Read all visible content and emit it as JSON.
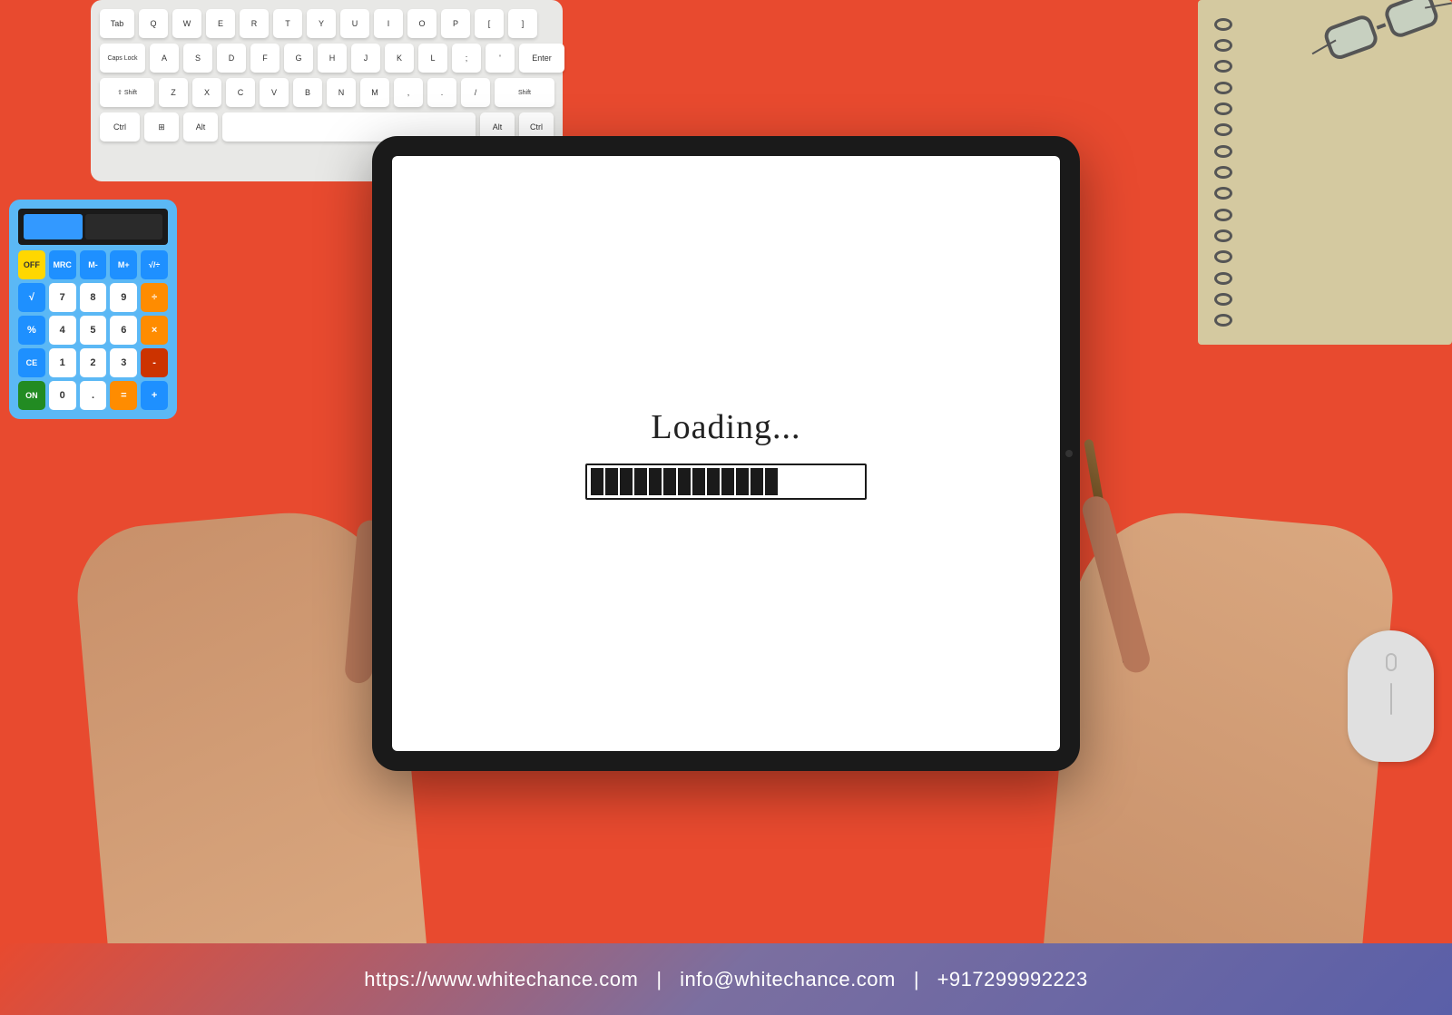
{
  "scene": {
    "background_color": "#e84a2f",
    "tablet": {
      "loading_text": "Loading...",
      "progress_segments": 13,
      "camera_dot": true
    },
    "calculator": {
      "rows": [
        [
          "OFF",
          "MRC",
          "M-",
          "M+",
          "√/÷"
        ],
        [
          "√",
          "7",
          "8",
          "9",
          "÷"
        ],
        [
          "%",
          "4",
          "5",
          "6",
          "×"
        ],
        [
          "CE",
          "1",
          "2",
          "3",
          "-"
        ],
        [
          "ON",
          "0",
          ".",
          "=",
          "+"
        ]
      ]
    },
    "keyboard": {
      "rows": [
        [
          "Tab",
          "Q",
          "W",
          "E",
          "R",
          "T",
          "Y",
          "U",
          "I",
          "O",
          "P"
        ],
        [
          "Caps Lock",
          "A",
          "S",
          "D",
          "F",
          "G",
          "H",
          "J",
          "K",
          "L"
        ],
        [
          "Shift",
          "Z",
          "X",
          "C",
          "V",
          "B",
          "N",
          "M"
        ],
        [
          "Ctrl",
          "Alt",
          "Ctrl"
        ]
      ]
    }
  },
  "footer": {
    "website": "https://www.whitechance.com",
    "divider1": "|",
    "email": "info@whitechance.com",
    "divider2": "|",
    "phone": "+917299992223",
    "background_start": "#e84a2f",
    "background_end": "#5a5fa8"
  }
}
